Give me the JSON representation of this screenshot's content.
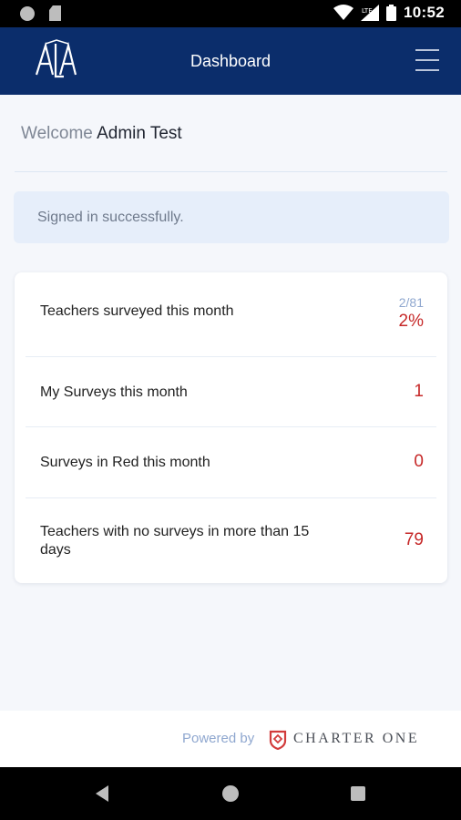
{
  "status_bar": {
    "time": "10:52",
    "network": "LTE"
  },
  "header": {
    "title": "Dashboard",
    "logo_text": "ALA",
    "menu_icon": "hamburger-menu-icon"
  },
  "welcome": {
    "prefix": "Welcome",
    "name": "Admin Test"
  },
  "alert": {
    "message": "Signed in successfully."
  },
  "stats": [
    {
      "label": "Teachers surveyed this month",
      "sub": "2/81",
      "value": "2%"
    },
    {
      "label": "My Surveys this month",
      "value": "1"
    },
    {
      "label": "Surveys in Red this month",
      "value": "0"
    },
    {
      "label": "Teachers with no surveys in more than 15",
      "label2": "days",
      "value": "79"
    }
  ],
  "footer": {
    "powered_by": "Powered by",
    "brand": "CHARTER ONE"
  },
  "colors": {
    "header_bg": "#0b2d6b",
    "accent_red": "#c62828",
    "muted_blue": "#8fa7cf",
    "alert_bg": "#e6eefa"
  }
}
